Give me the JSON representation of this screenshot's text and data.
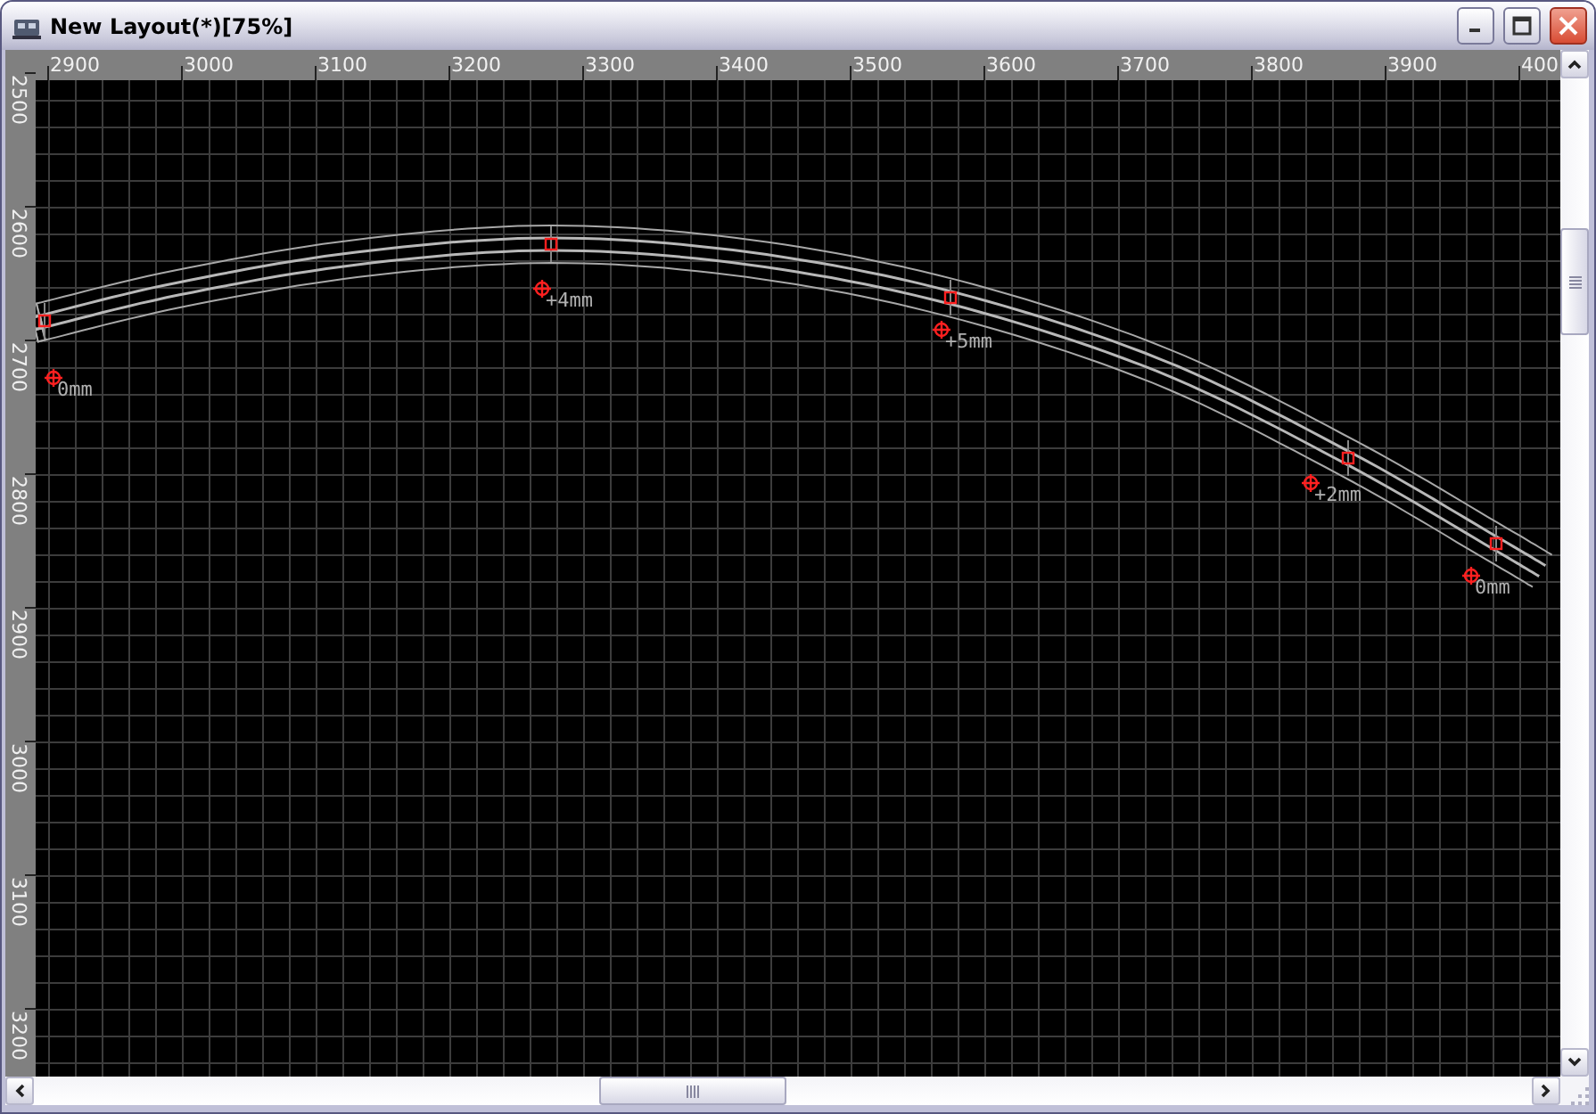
{
  "window": {
    "title": "New Layout(*)[75%]"
  },
  "ruler_x": {
    "labels": [
      "2900",
      "3000",
      "3100",
      "3200",
      "3300",
      "3400",
      "3500",
      "3600",
      "3700",
      "3800",
      "3900",
      "400"
    ]
  },
  "ruler_y": {
    "labels": [
      "2500",
      "2600",
      "2700",
      "2800",
      "2900",
      "3000",
      "3100",
      "3200"
    ]
  },
  "height_markers": [
    {
      "label": "0mm"
    },
    {
      "label": "+4mm"
    },
    {
      "label": "+5mm"
    },
    {
      "label": "+2mm"
    },
    {
      "label": "0mm"
    }
  ]
}
